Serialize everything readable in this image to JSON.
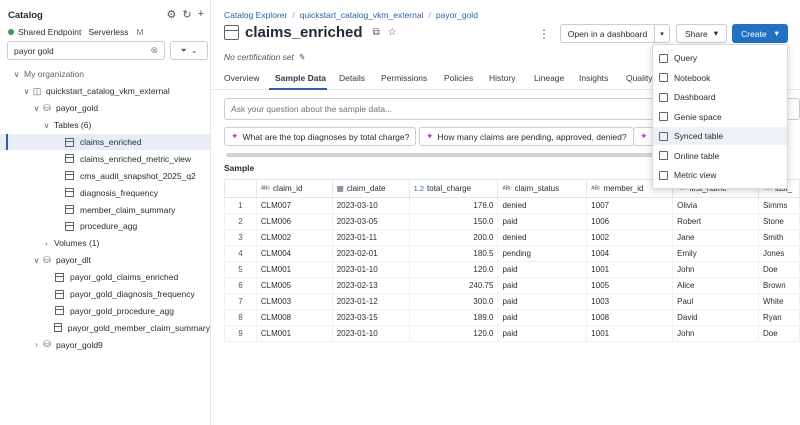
{
  "sidebar": {
    "title": "Catalog",
    "endpoint": "Shared Endpoint",
    "endpoint_type": "Serverless",
    "endpoint_extra": "M",
    "search_value": "payor gold",
    "tree": [
      {
        "label": "My organization",
        "indent": 0,
        "chev": "∨",
        "kind": "none",
        "muted": true
      },
      {
        "label": "quickstart_catalog_vkm_external",
        "indent": 1,
        "chev": "∨",
        "kind": "catalog"
      },
      {
        "label": "payor_gold",
        "indent": 2,
        "chev": "∨",
        "kind": "db"
      },
      {
        "label": "Tables (6)",
        "indent": 3,
        "chev": "∨",
        "kind": "none"
      },
      {
        "label": "claims_enriched",
        "indent": 4,
        "chev": "",
        "kind": "table",
        "selected": true
      },
      {
        "label": "claims_enriched_metric_view",
        "indent": 4,
        "chev": "",
        "kind": "table"
      },
      {
        "label": "cms_audit_snapshot_2025_q2",
        "indent": 4,
        "chev": "",
        "kind": "table"
      },
      {
        "label": "diagnosis_frequency",
        "indent": 4,
        "chev": "",
        "kind": "table"
      },
      {
        "label": "member_claim_summary",
        "indent": 4,
        "chev": "",
        "kind": "table"
      },
      {
        "label": "procedure_agg",
        "indent": 4,
        "chev": "",
        "kind": "table"
      },
      {
        "label": "Volumes (1)",
        "indent": 3,
        "chev": "›",
        "kind": "none"
      },
      {
        "label": "payor_dlt",
        "indent": 2,
        "chev": "∨",
        "kind": "db"
      },
      {
        "label": "payor_gold_claims_enriched",
        "indent": 3,
        "chev": "",
        "kind": "table"
      },
      {
        "label": "payor_gold_diagnosis_frequency",
        "indent": 3,
        "chev": "",
        "kind": "table"
      },
      {
        "label": "payor_gold_procedure_agg",
        "indent": 3,
        "chev": "",
        "kind": "table"
      },
      {
        "label": "payor_gold_member_claim_summary",
        "indent": 3,
        "chev": "",
        "kind": "table"
      },
      {
        "label": "payor_gold9",
        "indent": 2,
        "chev": "›",
        "kind": "db"
      }
    ]
  },
  "breadcrumb": [
    "Catalog Explorer",
    "quickstart_catalog_vkm_external",
    "payor_gold"
  ],
  "title": "claims_enriched",
  "certification": "No certification set",
  "buttons": {
    "open_dashboard": "Open in a dashboard",
    "share": "Share",
    "create": "Create"
  },
  "tabs": [
    "Overview",
    "Sample Data",
    "Details",
    "Permissions",
    "Policies",
    "History",
    "Lineage",
    "Insights",
    "Quality"
  ],
  "ask_placeholder": "Ask your question about the sample data...",
  "chips": [
    "What are the top diagnoses by total charge?",
    "How many claims are pending, approved, denied?"
  ],
  "sample_label": "Sample",
  "table": {
    "columns": [
      {
        "name": "claim_id",
        "type": "A B C"
      },
      {
        "name": "claim_date",
        "type": "cal"
      },
      {
        "name": "total_charge",
        "type": "1.2"
      },
      {
        "name": "claim_status",
        "type": "A B C"
      },
      {
        "name": "member_id",
        "type": "A B C"
      },
      {
        "name": "first_name",
        "type": "A B C"
      },
      {
        "name": "last_",
        "type": "A B C"
      }
    ],
    "rows": [
      [
        "1",
        "CLM007",
        "2023-03-10",
        "176.0",
        "denied",
        "1007",
        "Olivia",
        "Simms"
      ],
      [
        "2",
        "CLM006",
        "2023-03-05",
        "150.0",
        "paid",
        "1006",
        "Robert",
        "Stone"
      ],
      [
        "3",
        "CLM002",
        "2023-01-11",
        "200.0",
        "denied",
        "1002",
        "Jane",
        "Smith"
      ],
      [
        "4",
        "CLM004",
        "2023-02-01",
        "180.5",
        "pending",
        "1004",
        "Emily",
        "Jones"
      ],
      [
        "5",
        "CLM001",
        "2023-01-10",
        "120.0",
        "paid",
        "1001",
        "John",
        "Doe"
      ],
      [
        "6",
        "CLM005",
        "2023-02-13",
        "240.75",
        "paid",
        "1005",
        "Alice",
        "Brown"
      ],
      [
        "7",
        "CLM003",
        "2023-01-12",
        "300.0",
        "paid",
        "1003",
        "Paul",
        "White"
      ],
      [
        "8",
        "CLM008",
        "2023-03-15",
        "189.0",
        "paid",
        "1008",
        "David",
        "Ryan"
      ],
      [
        "9",
        "CLM001",
        "2023-01-10",
        "120.0",
        "paid",
        "1001",
        "John",
        "Doe"
      ]
    ]
  },
  "create_menu": [
    "Query",
    "Notebook",
    "Dashboard",
    "Genie space",
    "Synced table",
    "Online table",
    "Metric view"
  ],
  "create_menu_highlighted": "Synced table",
  "colors": {
    "accent": "#2271c3",
    "link": "#2f5fa6",
    "endpoint_status": "#2e9e4f"
  }
}
